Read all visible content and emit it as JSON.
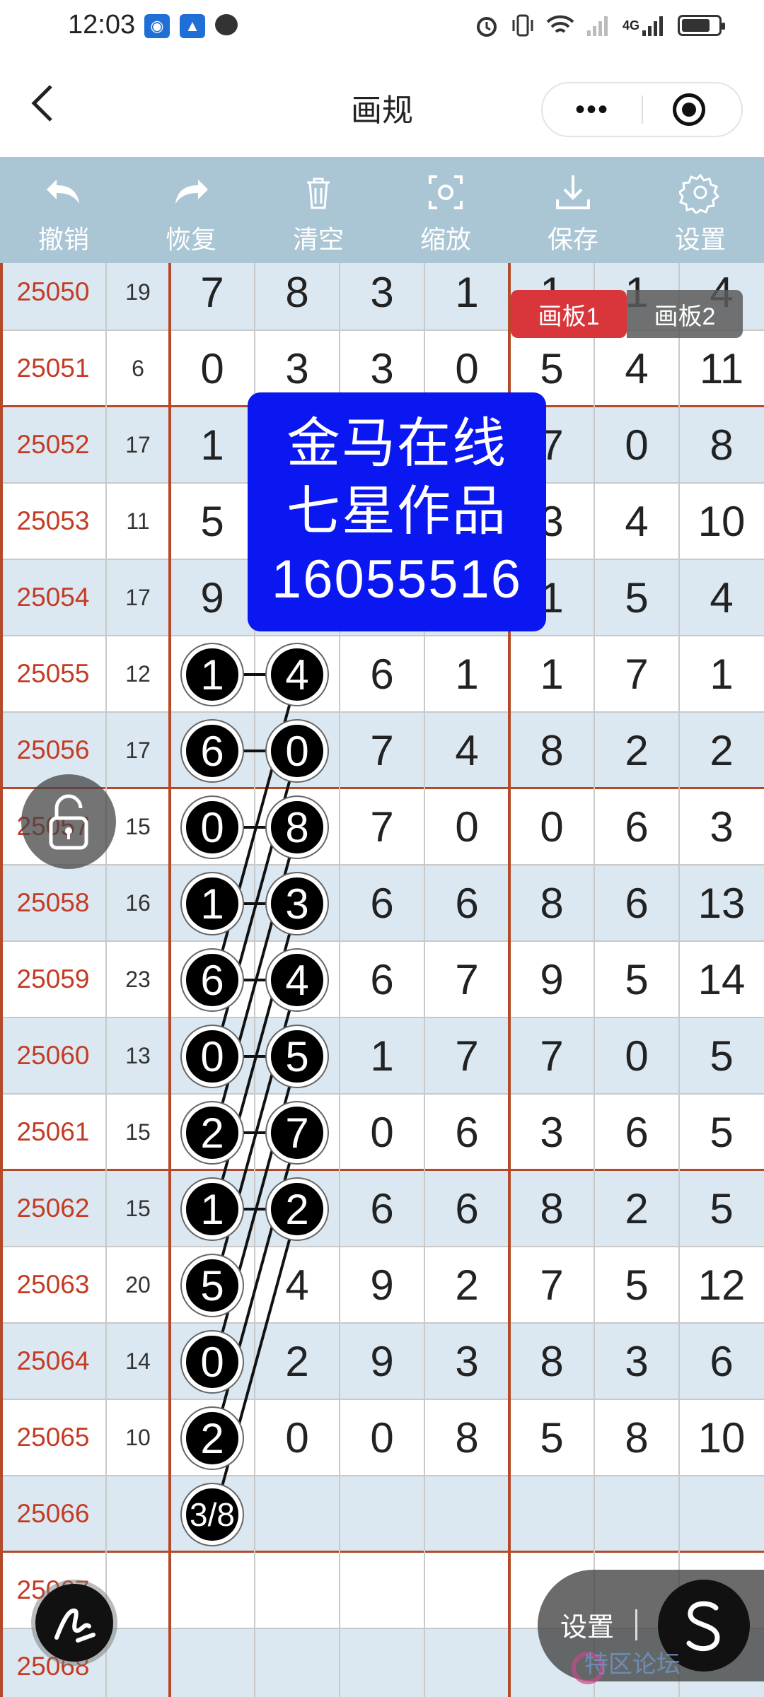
{
  "status_bar": {
    "time": "12:03",
    "network_label": "4G"
  },
  "nav": {
    "back_glyph": "<",
    "title": "画规",
    "more_glyph": "•••"
  },
  "toolbar": [
    {
      "label": "撤销",
      "icon": "undo-icon"
    },
    {
      "label": "恢复",
      "icon": "redo-icon"
    },
    {
      "label": "清空",
      "icon": "trash-icon"
    },
    {
      "label": "缩放",
      "icon": "zoom-icon"
    },
    {
      "label": "保存",
      "icon": "download-icon"
    },
    {
      "label": "设置",
      "icon": "gear-icon"
    }
  ],
  "tabs": {
    "board1": "画板1",
    "board2": "画板2"
  },
  "banner": {
    "line1": "金马在线",
    "line2": "七星作品",
    "line3": "16055516"
  },
  "grid": {
    "rows": [
      {
        "id": "25050",
        "sum": "19",
        "digits": [
          "7",
          "8",
          "3",
          "1",
          "1",
          "1",
          "4"
        ]
      },
      {
        "id": "25051",
        "sum": "6",
        "digits": [
          "0",
          "3",
          "3",
          "0",
          "5",
          "4",
          "11"
        ]
      },
      {
        "id": "25052",
        "sum": "17",
        "digits": [
          "1",
          "",
          "",
          "",
          "7",
          "0",
          "8"
        ]
      },
      {
        "id": "25053",
        "sum": "11",
        "digits": [
          "5",
          "",
          "",
          "",
          "3",
          "4",
          "10"
        ]
      },
      {
        "id": "25054",
        "sum": "17",
        "digits": [
          "9",
          "",
          "",
          "",
          "1",
          "5",
          "4"
        ]
      },
      {
        "id": "25055",
        "sum": "12",
        "digits": [
          "",
          "",
          "6",
          "1",
          "1",
          "7",
          "1"
        ]
      },
      {
        "id": "25056",
        "sum": "17",
        "digits": [
          "",
          "",
          "7",
          "4",
          "8",
          "2",
          "2"
        ]
      },
      {
        "id": "25057",
        "sum": "15",
        "digits": [
          "",
          "",
          "7",
          "0",
          "0",
          "6",
          "3"
        ]
      },
      {
        "id": "25058",
        "sum": "16",
        "digits": [
          "",
          "",
          "6",
          "6",
          "8",
          "6",
          "13"
        ]
      },
      {
        "id": "25059",
        "sum": "23",
        "digits": [
          "",
          "",
          "6",
          "7",
          "9",
          "5",
          "14"
        ]
      },
      {
        "id": "25060",
        "sum": "13",
        "digits": [
          "",
          "",
          "1",
          "7",
          "7",
          "0",
          "5"
        ]
      },
      {
        "id": "25061",
        "sum": "15",
        "digits": [
          "",
          "",
          "0",
          "6",
          "3",
          "6",
          "5"
        ]
      },
      {
        "id": "25062",
        "sum": "15",
        "digits": [
          "",
          "",
          "6",
          "6",
          "8",
          "2",
          "5"
        ]
      },
      {
        "id": "25063",
        "sum": "20",
        "digits": [
          "",
          "4",
          "9",
          "2",
          "7",
          "5",
          "12"
        ]
      },
      {
        "id": "25064",
        "sum": "14",
        "digits": [
          "",
          "2",
          "9",
          "3",
          "8",
          "3",
          "6"
        ]
      },
      {
        "id": "25065",
        "sum": "10",
        "digits": [
          "",
          "0",
          "0",
          "8",
          "5",
          "8",
          "10"
        ]
      },
      {
        "id": "25066",
        "sum": "",
        "digits": [
          "",
          "",
          "",
          "",
          "",
          "",
          ""
        ]
      },
      {
        "id": "25067",
        "sum": "",
        "digits": [
          "",
          "",
          "",
          "",
          "",
          "",
          ""
        ]
      },
      {
        "id": "25068",
        "sum": "",
        "digits": [
          "",
          "",
          "",
          "",
          "",
          "",
          ""
        ]
      }
    ]
  },
  "balls": {
    "col1": [
      "1",
      "6",
      "0",
      "1",
      "6",
      "0",
      "2",
      "1",
      "5",
      "0",
      "2",
      "3/8"
    ],
    "col2": [
      "4",
      "0",
      "8",
      "3",
      "4",
      "5",
      "7",
      "2"
    ]
  },
  "floating": {
    "settings_label": "设置",
    "s_glyph": "S"
  },
  "watermark": "特区论坛"
}
